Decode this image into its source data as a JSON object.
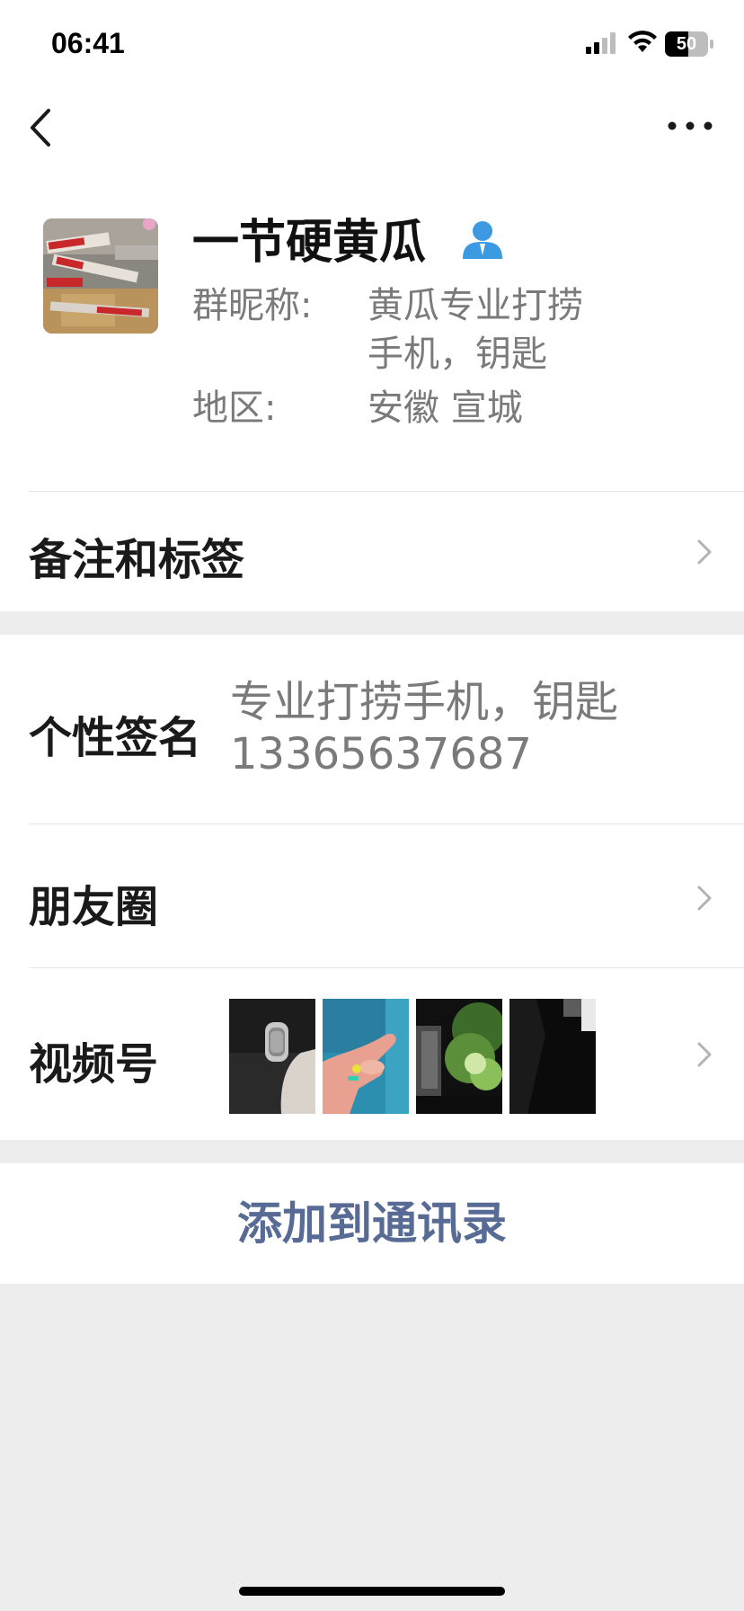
{
  "status": {
    "time": "06:41",
    "battery": "50"
  },
  "profile": {
    "name": "一节硬黄瓜",
    "group_nickname_label": "群昵称:",
    "group_nickname_line1": "黄瓜专业打捞",
    "group_nickname_line2": "手机，钥匙",
    "region_label": "地区:",
    "region_value": "安徽 宣城"
  },
  "rows": {
    "remarks_tags": "备注和标签",
    "signature_label": "个性签名",
    "signature_line1": "专业打捞手机，钥匙",
    "signature_line2": "13365637687",
    "moments": "朋友圈",
    "channels": "视频号"
  },
  "actions": {
    "add_to_contacts": "添加到通讯录"
  },
  "colors": {
    "link": "#576b95",
    "background": "#ededed",
    "badge": "#3b9ae1"
  },
  "icons": {
    "back": "chevron-left-icon",
    "more": "more-dots-icon",
    "badge": "person-badge-icon",
    "chevron": "chevron-right-icon"
  }
}
